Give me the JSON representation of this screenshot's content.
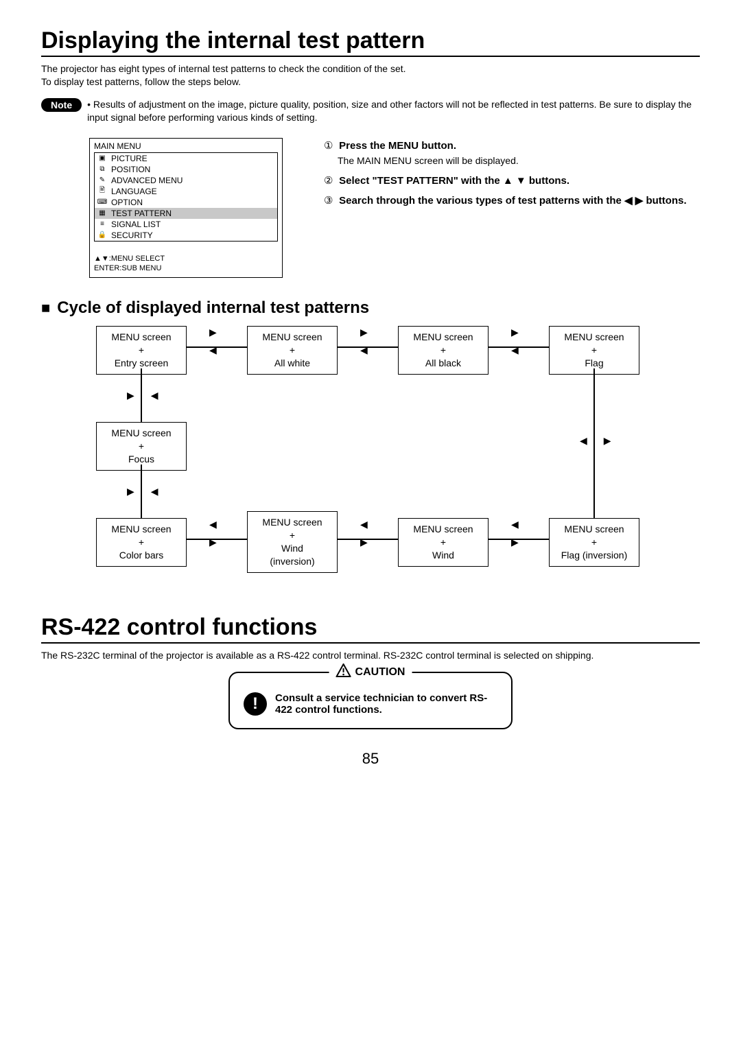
{
  "page_number": "85",
  "section1": {
    "title": "Displaying the internal test pattern",
    "intro_line1": "The projector has eight types of internal test patterns to check the condition of the set.",
    "intro_line2": "To display test patterns, follow the steps below.",
    "note_badge": "Note",
    "note_text": "• Results of adjustment on the image, picture quality, position, size and other factors will not be reflected in test patterns.  Be sure to display the input signal before performing various kinds of setting."
  },
  "menu": {
    "title": "MAIN MENU",
    "items": [
      {
        "icon": "▣",
        "label": "PICTURE",
        "sel": false
      },
      {
        "icon": "⧉",
        "label": "POSITION",
        "sel": false
      },
      {
        "icon": "✎",
        "label": "ADVANCED MENU",
        "sel": false
      },
      {
        "icon": "🖹",
        "label": "LANGUAGE",
        "sel": false
      },
      {
        "icon": "⌨",
        "label": "OPTION",
        "sel": false
      },
      {
        "icon": "▦",
        "label": "TEST PATTERN",
        "sel": true
      },
      {
        "icon": "≡",
        "label": "SIGNAL LIST",
        "sel": false
      },
      {
        "icon": "🔒",
        "label": "SECURITY",
        "sel": false
      }
    ],
    "hint1": "▲▼:MENU SELECT",
    "hint2": "ENTER:SUB MENU"
  },
  "steps": {
    "s1_num": "①",
    "s1_bold": "Press the MENU button.",
    "s1_sub": "The MAIN MENU screen will be displayed.",
    "s2_num": "②",
    "s2_bold": "Select \"TEST PATTERN\" with the  ▲ ▼ buttons.",
    "s3_num": "③",
    "s3_bold": "Search through the various types of test patterns with the  ◀  ▶  buttons."
  },
  "cycle": {
    "heading": "Cycle of displayed internal test patterns",
    "nodes": {
      "n1": "MENU screen\n+\nEntry screen",
      "n2": "MENU screen\n+\nAll white",
      "n3": "MENU screen\n+\nAll black",
      "n4": "MENU screen\n+\nFlag",
      "n5": "MENU screen\n+\nFocus",
      "n6": "MENU screen\n+\nColor bars",
      "n7": "MENU screen\n+\nWind\n(inversion)",
      "n8": "MENU screen\n+\nWind",
      "n9": "MENU screen\n+\nFlag (inversion)"
    }
  },
  "section2": {
    "title": "RS-422 control functions",
    "intro": "The RS-232C terminal of the projector is available as a RS-422 control terminal. RS-232C control terminal is selected on shipping.",
    "caution_label": "CAUTION",
    "caution_text": "Consult a service technician to convert RS-422 control functions."
  }
}
